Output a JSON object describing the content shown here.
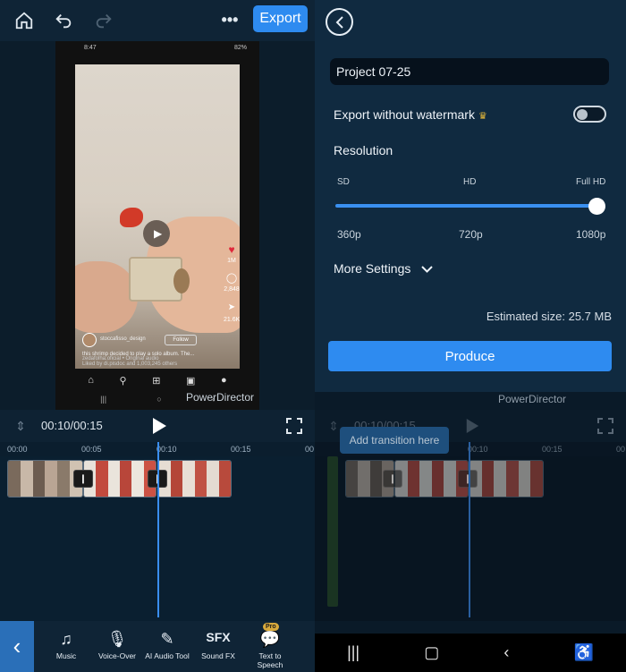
{
  "left": {
    "topbar": {
      "home_icon": "home-icon",
      "undo_icon": "undo-icon",
      "redo_icon": "redo-icon",
      "more_icon": "more-icon",
      "export_label": "Export"
    },
    "phone": {
      "time": "8:47",
      "status": "82%",
      "username": "stoccafisso_design",
      "follow": "Follow",
      "caption": "this shrimp decided to play a solo album. The...",
      "liked_by": "Liked by di.pisdoc and 1,003,245 others",
      "audio": "zedafolha.oficial • Original audio",
      "likes": "1M",
      "comments": "2,848",
      "shares": "21.6K"
    },
    "watermark": "PowerDirector",
    "controls": {
      "time": "00:10/00:15"
    },
    "ruler": [
      "00:00",
      "00:05",
      "00:10",
      "00:15",
      "00"
    ],
    "tools": [
      {
        "icon": "music-icon",
        "label": "Music"
      },
      {
        "icon": "microphone-icon",
        "label": "Voice-Over"
      },
      {
        "icon": "ai-audio-icon",
        "label": "AI Audio Tool"
      },
      {
        "icon": "sfx-icon",
        "label": "Sound FX"
      },
      {
        "icon": "text-to-speech-icon",
        "label": "Text to Speech",
        "badge": "Pro"
      }
    ]
  },
  "right": {
    "project_name": "Project 07-25",
    "export_watermark_label": "Export without watermark",
    "watermark_toggle": "off",
    "resolution_label": "Resolution",
    "resolution_levels": [
      "SD",
      "HD",
      "Full HD"
    ],
    "resolution_values": [
      "360p",
      "720p",
      "1080p"
    ],
    "resolution_selected": "1080p",
    "more_settings": "More Settings",
    "estimated_size": "Estimated size: 25.7 MB",
    "produce_label": "Produce",
    "watermark": "PowerDirector",
    "time": "00:10/00:15",
    "ruler": [
      "00:10",
      "00:15",
      "00"
    ],
    "tooltip": "Add transition here"
  },
  "colors": {
    "accent": "#2e8bf0",
    "background": "#0e2233",
    "crown": "#e6b93a",
    "pro_badge": "#d8a93c"
  }
}
